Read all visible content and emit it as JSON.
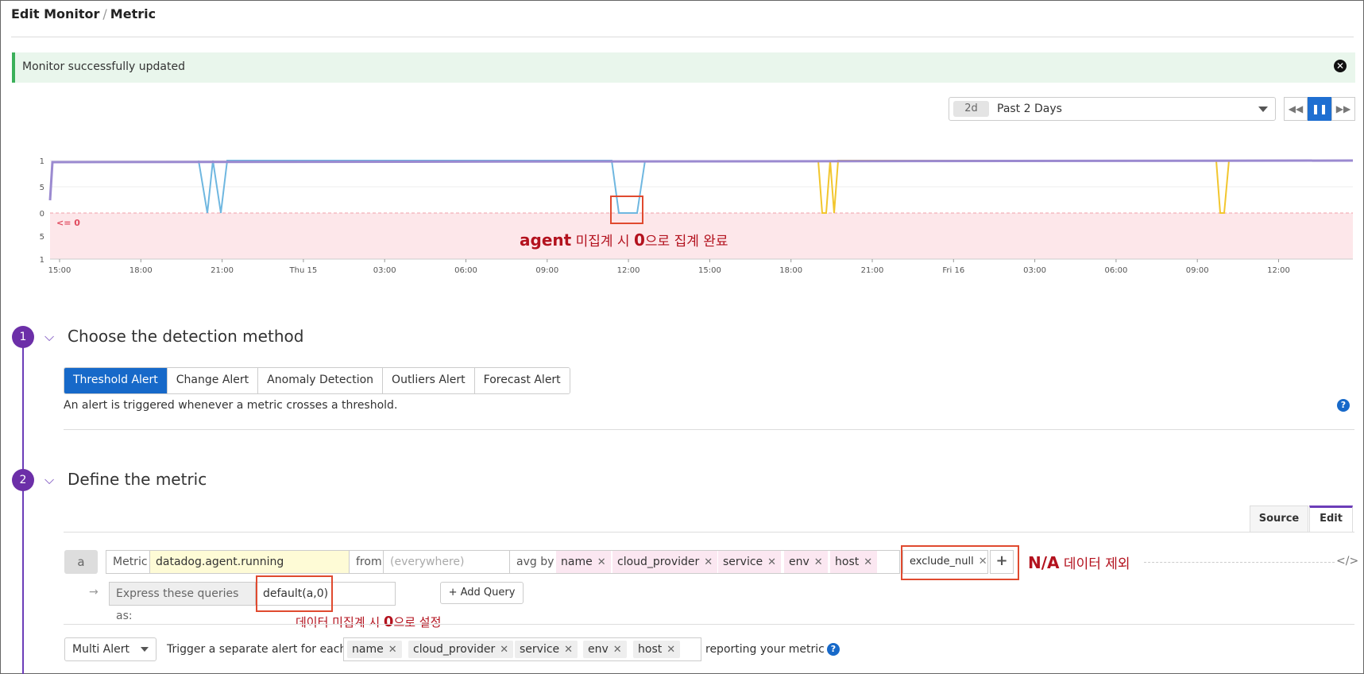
{
  "header": {
    "title": "Edit Monitor",
    "separator": "/",
    "subtitle": "Metric"
  },
  "banner": {
    "message": "Monitor successfully updated"
  },
  "time_selector": {
    "badge": "2d",
    "label": "Past 2 Days"
  },
  "chart": {
    "y_ticks": [
      "1",
      "0.5",
      "0",
      "-0.5",
      "-1"
    ],
    "x_ticks": [
      "15:00",
      "18:00",
      "21:00",
      "Thu 15",
      "03:00",
      "06:00",
      "09:00",
      "12:00",
      "15:00",
      "18:00",
      "21:00",
      "Fri 16",
      "03:00",
      "06:00",
      "09:00",
      "12:00"
    ],
    "threshold_label": "<= 0",
    "colors": {
      "series_main": "#9b8ad0",
      "series_blue": "#6fb7e0",
      "series_yellow": "#f2c62e",
      "threshold_fill": "#fde7ea",
      "threshold_text": "#e04a5e"
    }
  },
  "annotations": {
    "chart_note_bold": "agent",
    "chart_note_mid": " 미집계 시 ",
    "chart_note_zero": "0",
    "chart_note_end": "으로 집계 완료",
    "na_bold": "N/A",
    "na_rest": " 데이터 제외",
    "default_pre": "데이터 미집계 시 ",
    "default_zero": "0",
    "default_end": "으로 설정"
  },
  "step1": {
    "number": "1",
    "title": "Choose the detection method",
    "tabs": [
      "Threshold Alert",
      "Change Alert",
      "Anomaly Detection",
      "Outliers Alert",
      "Forecast Alert"
    ],
    "description": "An alert is triggered whenever a metric crosses a threshold."
  },
  "step2": {
    "number": "2",
    "title": "Define the metric",
    "source_tab": "Source",
    "edit_tab": "Edit",
    "query": {
      "letter": "a",
      "metric_label": "Metric",
      "metric_value": "datadog.agent.running",
      "from_label": "from",
      "from_placeholder": "(everywhere)",
      "avg_by_label": "avg by",
      "group_tags": [
        "name",
        "cloud_provider",
        "service",
        "env",
        "host"
      ],
      "exclude_tag": "exclude_null",
      "remove_symbol": "✕"
    },
    "express_label": "Express these queries as:",
    "express_value": "default(a,0)",
    "add_query_label": "Add Query",
    "multi_alert_label": "Multi Alert",
    "trigger_text": "Trigger a separate alert for each",
    "trigger_tags": [
      "name",
      "cloud_provider",
      "service",
      "env",
      "host"
    ],
    "reporting_text": "reporting your metric"
  }
}
